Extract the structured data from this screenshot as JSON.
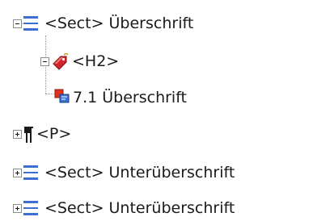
{
  "tree": {
    "nodes": [
      {
        "label": "<Sect> Überschrift",
        "icon": "section-icon",
        "toggle": "minus"
      },
      {
        "label": "<H2>",
        "icon": "tag-icon",
        "toggle": "minus"
      },
      {
        "label": "7.1 Überschrift",
        "icon": "content-icon",
        "toggle": "none"
      },
      {
        "label": "<P>",
        "icon": "paragraph-icon",
        "toggle": "plus"
      },
      {
        "label": "<Sect> Unterüberschrift",
        "icon": "section-icon",
        "toggle": "plus"
      },
      {
        "label": "<Sect> Unterüberschrift",
        "icon": "section-icon",
        "toggle": "plus"
      }
    ]
  },
  "colors": {
    "section_blue": "#3d6fd0",
    "tag_red": "#d2242a",
    "content_red": "#e03020",
    "content_blue": "#3a73d8",
    "text": "#1a1a1a"
  }
}
